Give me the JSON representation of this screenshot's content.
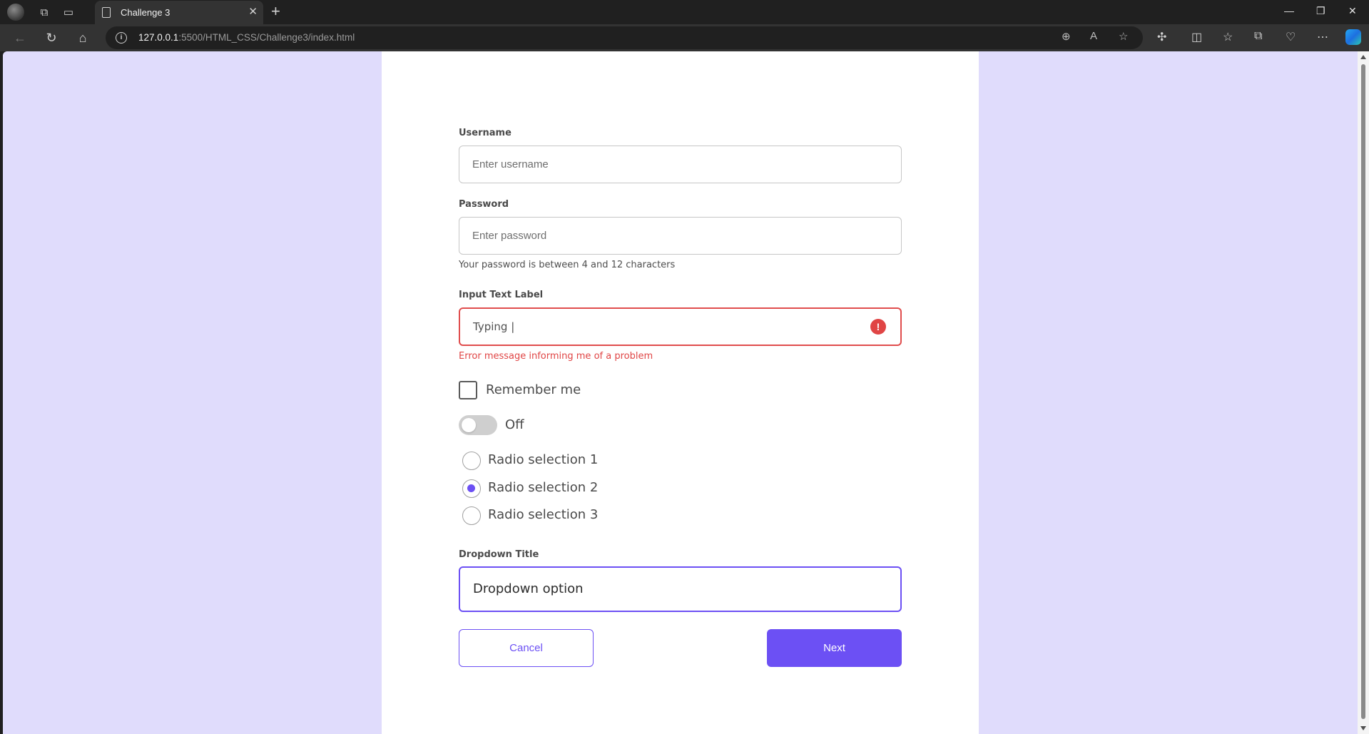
{
  "browser": {
    "tab_title": "Challenge 3",
    "tab_close": "✕",
    "new_tab": "+",
    "url_host": "127.0.0.1",
    "url_rest": ":5500/HTML_CSS/Challenge3/index.html",
    "window_controls": [
      "—",
      "❐",
      "✕"
    ]
  },
  "form": {
    "username": {
      "label": "Username",
      "placeholder": "Enter username"
    },
    "password": {
      "label": "Password",
      "placeholder": "Enter password",
      "helper": "Your password is between 4 and 12 characters"
    },
    "input_text": {
      "label": "Input Text Label",
      "value": "Typing |",
      "error_icon": "!",
      "error": "Error message informing me of a problem"
    },
    "remember": {
      "label": "Remember me",
      "checked": false
    },
    "toggle": {
      "label": "Off",
      "on": false
    },
    "radios": [
      {
        "label": "Radio selection 1",
        "checked": false
      },
      {
        "label": "Radio selection 2",
        "checked": true
      },
      {
        "label": "Radio selection 3",
        "checked": false
      }
    ],
    "dropdown": {
      "label": "Dropdown Title",
      "value": "Dropdown option"
    },
    "cancel_label": "Cancel",
    "next_label": "Next"
  },
  "colors": {
    "accent": "#6c50f4",
    "error": "#e04545",
    "page_background": "#e0dcfc"
  }
}
